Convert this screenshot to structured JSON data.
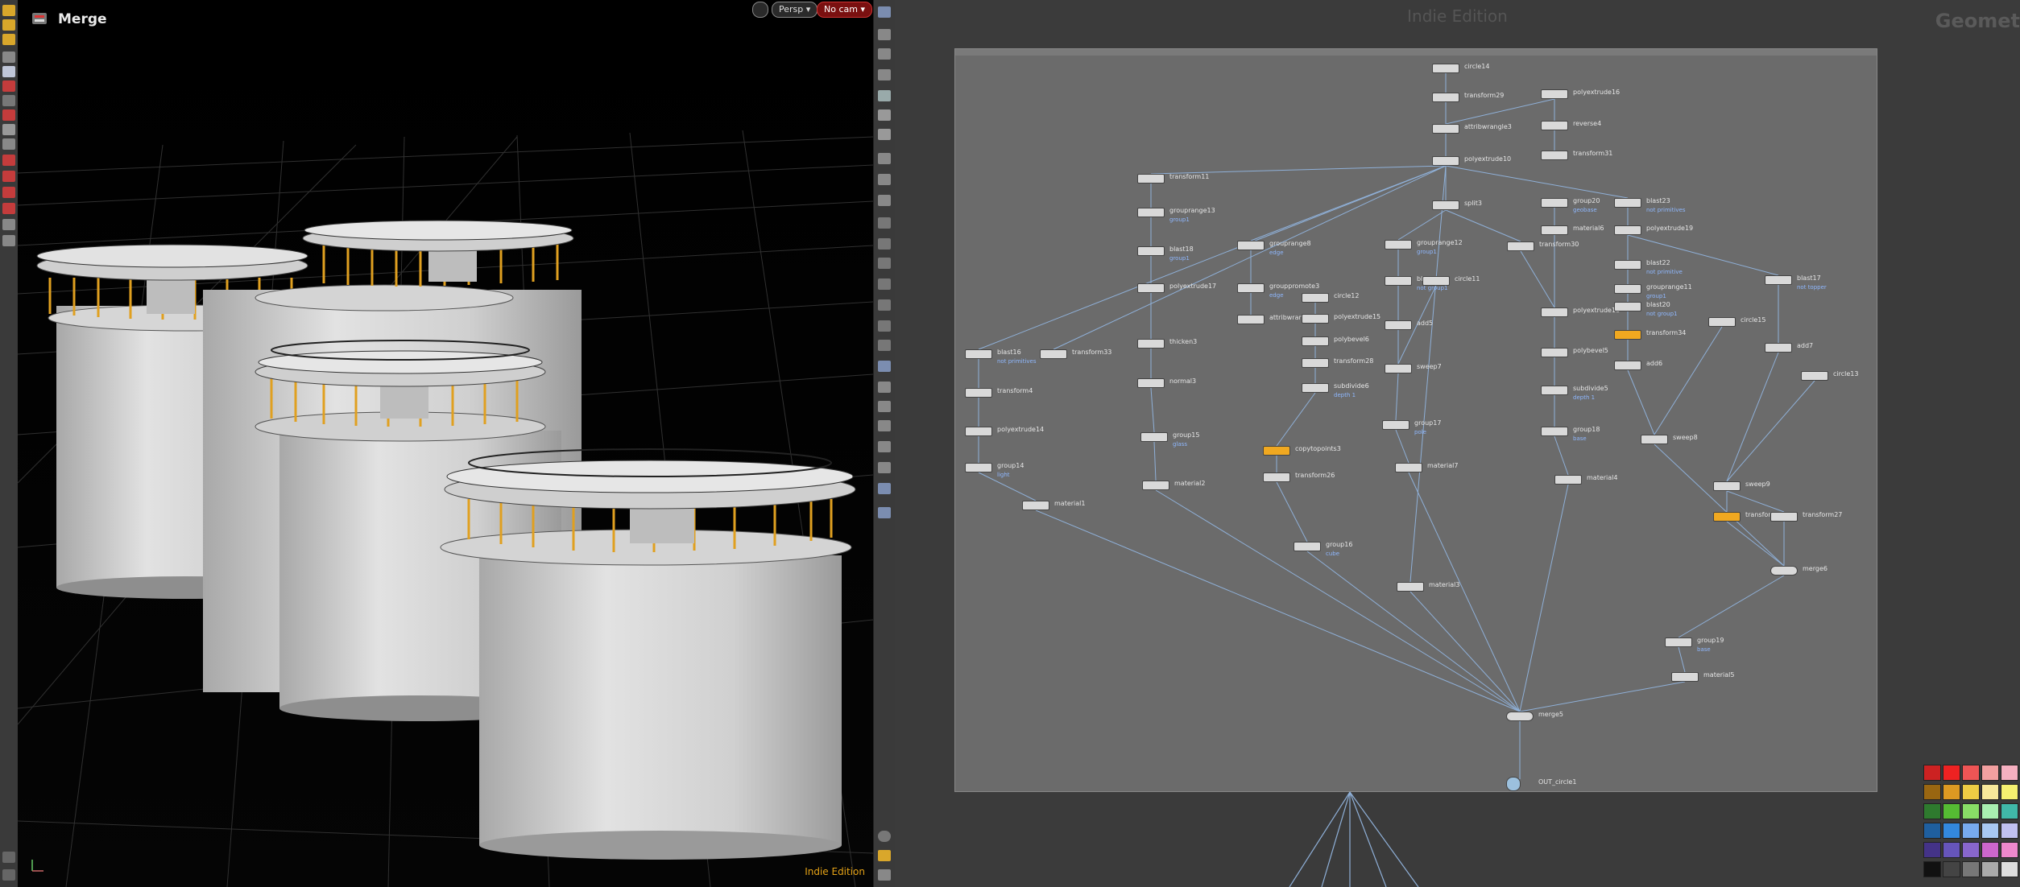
{
  "viewport": {
    "title": "Merge",
    "camera_mode": "Persp",
    "camera": "No cam",
    "watermark": "Indie Edition"
  },
  "network": {
    "edition": "Indie Edition",
    "context": "Geomet"
  },
  "nodes": [
    {
      "name": "circle14",
      "comment": ""
    },
    {
      "name": "transform29",
      "comment": ""
    },
    {
      "name": "attribwrangle3",
      "comment": ""
    },
    {
      "name": "polyextrude10",
      "comment": ""
    },
    {
      "name": "polyextrude16",
      "comment": ""
    },
    {
      "name": "reverse4",
      "comment": ""
    },
    {
      "name": "transform31",
      "comment": ""
    },
    {
      "name": "transform11",
      "comment": ""
    },
    {
      "name": "grouprange13",
      "comment": "group1"
    },
    {
      "name": "blast18",
      "comment": "group1"
    },
    {
      "name": "polyextrude17",
      "comment": ""
    },
    {
      "name": "thicken3",
      "comment": ""
    },
    {
      "name": "normal3",
      "comment": ""
    },
    {
      "name": "group15",
      "comment": "glass"
    },
    {
      "name": "material2",
      "comment": ""
    },
    {
      "name": "grouprange8",
      "comment": "edge"
    },
    {
      "name": "grouppromote3",
      "comment": "edge"
    },
    {
      "name": "attribwrangle4",
      "comment": ""
    },
    {
      "name": "circle12",
      "comment": ""
    },
    {
      "name": "polyextrude15",
      "comment": ""
    },
    {
      "name": "polybevel6",
      "comment": ""
    },
    {
      "name": "transform28",
      "comment": ""
    },
    {
      "name": "subdivide6",
      "comment": "depth 1"
    },
    {
      "name": "copytopoints3",
      "comment": ""
    },
    {
      "name": "transform26",
      "comment": ""
    },
    {
      "name": "group16",
      "comment": "cube"
    },
    {
      "name": "split3",
      "comment": ""
    },
    {
      "name": "grouprange12",
      "comment": "group1"
    },
    {
      "name": "blast21",
      "comment": "not group1"
    },
    {
      "name": "circle11",
      "comment": ""
    },
    {
      "name": "add5",
      "comment": ""
    },
    {
      "name": "sweep7",
      "comment": ""
    },
    {
      "name": "group17",
      "comment": "pole"
    },
    {
      "name": "material7",
      "comment": ""
    },
    {
      "name": "material3",
      "comment": ""
    },
    {
      "name": "transform30",
      "comment": ""
    },
    {
      "name": "group20",
      "comment": "geobase"
    },
    {
      "name": "material6",
      "comment": ""
    },
    {
      "name": "polyextrude18",
      "comment": ""
    },
    {
      "name": "polybevel5",
      "comment": ""
    },
    {
      "name": "subdivide5",
      "comment": "depth 1"
    },
    {
      "name": "group18",
      "comment": "base"
    },
    {
      "name": "material4",
      "comment": ""
    },
    {
      "name": "blast23",
      "comment": "not primitives"
    },
    {
      "name": "polyextrude19",
      "comment": ""
    },
    {
      "name": "blast22",
      "comment": "not primitive"
    },
    {
      "name": "grouprange11",
      "comment": "group1"
    },
    {
      "name": "blast20",
      "comment": "not group1"
    },
    {
      "name": "transform34",
      "comment": ""
    },
    {
      "name": "add6",
      "comment": ""
    },
    {
      "name": "circle15",
      "comment": ""
    },
    {
      "name": "blast17",
      "comment": "not topper"
    },
    {
      "name": "add7",
      "comment": ""
    },
    {
      "name": "circle13",
      "comment": ""
    },
    {
      "name": "sweep8",
      "comment": ""
    },
    {
      "name": "sweep9",
      "comment": ""
    },
    {
      "name": "transform",
      "comment": ""
    },
    {
      "name": "transform27",
      "comment": ""
    },
    {
      "name": "merge6",
      "comment": ""
    },
    {
      "name": "group19",
      "comment": "base"
    },
    {
      "name": "material5",
      "comment": ""
    },
    {
      "name": "blast16",
      "comment": "not primitives"
    },
    {
      "name": "transform33",
      "comment": ""
    },
    {
      "name": "transform4",
      "comment": ""
    },
    {
      "name": "polyextrude14",
      "comment": ""
    },
    {
      "name": "group14",
      "comment": "light"
    },
    {
      "name": "material1",
      "comment": ""
    },
    {
      "name": "merge5",
      "comment": ""
    },
    {
      "name": "OUT_circle1",
      "comment": ""
    }
  ],
  "palette_colors": [
    "#cc2222",
    "#ee2222",
    "#ee5555",
    "#f2a0a0",
    "#f5b0c0",
    "#996611",
    "#dd9922",
    "#eecc44",
    "#f7e89a",
    "#f5f070",
    "#2e7a2e",
    "#55bb33",
    "#88dd66",
    "#a8eeb0",
    "#40b8a8",
    "#1f5f9f",
    "#3388dd",
    "#77aaee",
    "#a8c8f2",
    "#c0c0f0",
    "#443388",
    "#6655bb",
    "#8866cc",
    "#cc66cc",
    "#ee88cc",
    "#111111",
    "#444444",
    "#777777",
    "#aaaaaa",
    "#dddddd"
  ]
}
